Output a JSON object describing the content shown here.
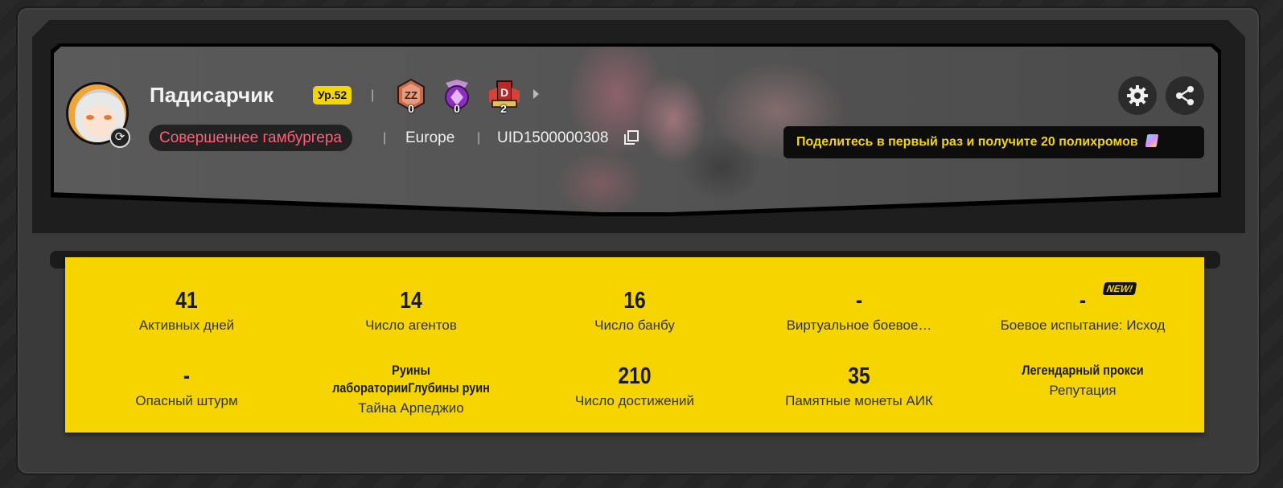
{
  "profile": {
    "username": "Падисарчик",
    "level": "Ур.52",
    "title": "Совершеннее гамбургера",
    "region": "Europe",
    "uid": "UID1500000308",
    "medals": [
      {
        "name": "medal-zzz",
        "count": "0",
        "color": "#d87a5a"
      },
      {
        "name": "medal-purple-gem",
        "count": "0",
        "color": "#a04fd0"
      },
      {
        "name": "medal-red-crest",
        "count": "2",
        "color": "#c8302f"
      }
    ],
    "separator": "|"
  },
  "actions": {
    "settings_icon": "gear-icon",
    "share_icon": "share-icon"
  },
  "promo": {
    "text": "Поделитесь в первый раз и получите 20 полихромов",
    "icon": "polychrome-icon"
  },
  "stats": {
    "row1": [
      {
        "value": "41",
        "label": "Активных дней"
      },
      {
        "value": "14",
        "label": "Число агентов"
      },
      {
        "value": "16",
        "label": "Число банбу"
      },
      {
        "value": "-",
        "label": "Виртуальное боевое…"
      },
      {
        "value": "-",
        "label": "Боевое испытание: Исход"
      }
    ],
    "row2": [
      {
        "value": "-",
        "label": "Опасный штурм"
      },
      {
        "value": "Руины лабораторииГлубины руин",
        "label": "Тайна Арпеджио"
      },
      {
        "value": "210",
        "label": "Число достижений"
      },
      {
        "value": "35",
        "label": "Памятные монеты АИК"
      },
      {
        "value": "Легендарный прокси",
        "label": "Репутация"
      }
    ],
    "new_tag": "NEW!"
  },
  "colors": {
    "accent_yellow": "#f5d400",
    "title_pink": "#ff5f7a"
  }
}
